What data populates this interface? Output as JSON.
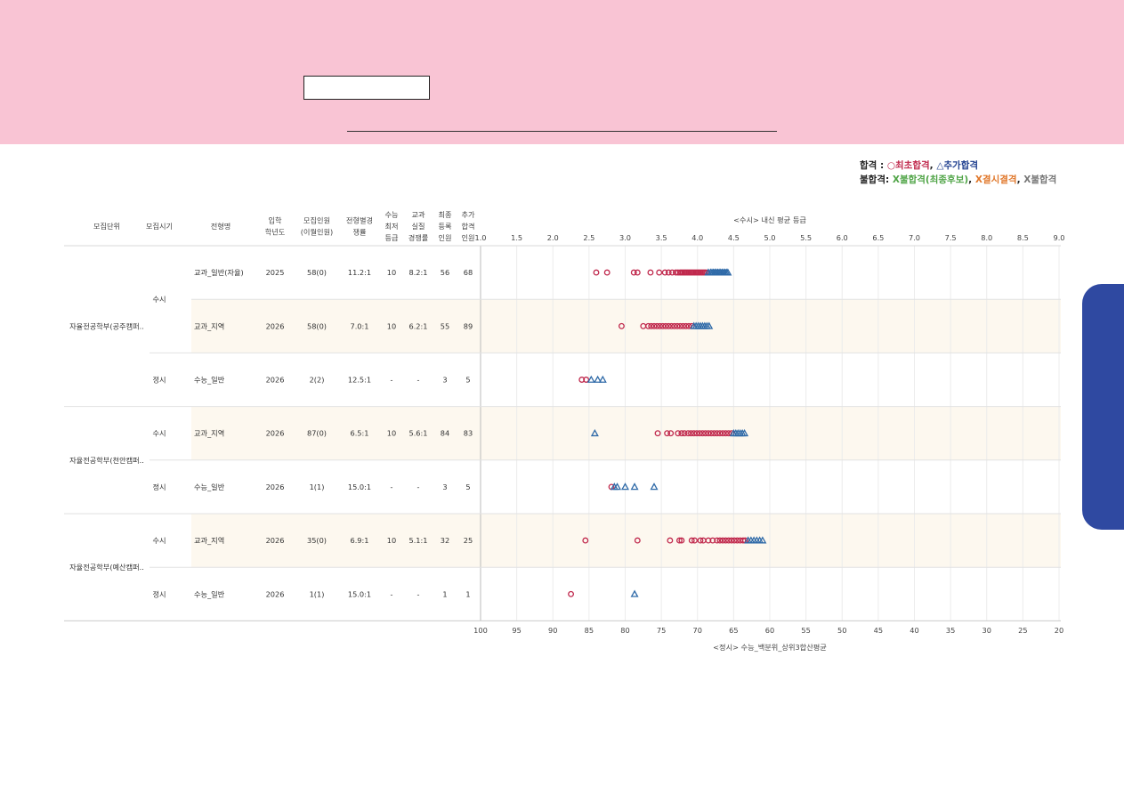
{
  "legend": {
    "pass_label": "합격",
    "pass_sep": " : ",
    "pass_first": "○최초합격",
    "pass_comma": ", ",
    "pass_add": "△추가합격",
    "fail_label": "불합격:",
    "fail_x1": "X불합격(최종후보)",
    "fail_comma1": ", ",
    "fail_x2": "X결시결격",
    "fail_comma2": ", ",
    "fail_x3": "X불합격"
  },
  "colors": {
    "first": "#c0294d",
    "additional": "#2f6aa8",
    "fail_final": "#4fa446",
    "fail_absent": "#e0772a",
    "fail": "#777777",
    "stripe": "#fdf8ef",
    "side_tab": "#2f49a1",
    "banner": "#f9c4d4"
  },
  "table": {
    "headers": [
      {
        "key": "unit",
        "lines": [
          "모집단위"
        ]
      },
      {
        "key": "period",
        "lines": [
          "모집시기"
        ]
      },
      {
        "key": "type",
        "lines": [
          "전형명"
        ]
      },
      {
        "key": "year",
        "lines": [
          "입학",
          "학년도"
        ]
      },
      {
        "key": "quota",
        "lines": [
          "모집인원",
          "(이월인원)"
        ]
      },
      {
        "key": "comp",
        "lines": [
          "전형별경",
          "쟁률"
        ]
      },
      {
        "key": "min",
        "lines": [
          "수능",
          "최저",
          "등급"
        ]
      },
      {
        "key": "real",
        "lines": [
          "교과",
          "실질",
          "경쟁률"
        ]
      },
      {
        "key": "reg",
        "lines": [
          "최종",
          "등록",
          "인원"
        ]
      },
      {
        "key": "add",
        "lines": [
          "추가",
          "합격",
          "인원"
        ]
      }
    ],
    "groups": [
      {
        "unit": "자율전공학부(공주캠퍼..",
        "periods": [
          {
            "name": "수시",
            "rows": 2
          },
          {
            "name": "정시",
            "rows": 1
          }
        ]
      },
      {
        "unit": "자율전공학부(천안캠퍼..",
        "periods": [
          {
            "name": "수시",
            "rows": 1
          },
          {
            "name": "정시",
            "rows": 1
          }
        ]
      },
      {
        "unit": "자율전공학부(예산캠퍼..",
        "periods": [
          {
            "name": "수시",
            "rows": 1
          },
          {
            "name": "정시",
            "rows": 1
          }
        ]
      }
    ],
    "rows": [
      {
        "type": "교과_일반(자율)",
        "year": "2025",
        "quota": "58(0)",
        "comp": "11.2:1",
        "min": "10",
        "real": "8.2:1",
        "reg": "56",
        "add": "68",
        "axis": "grade"
      },
      {
        "type": "교과_지역",
        "year": "2026",
        "quota": "58(0)",
        "comp": "7.0:1",
        "min": "10",
        "real": "6.2:1",
        "reg": "55",
        "add": "89",
        "axis": "grade"
      },
      {
        "type": "수능_일반",
        "year": "2026",
        "quota": "2(2)",
        "comp": "12.5:1",
        "min": "-",
        "real": "-",
        "reg": "3",
        "add": "5",
        "axis": "grade"
      },
      {
        "type": "교과_지역",
        "year": "2026",
        "quota": "87(0)",
        "comp": "6.5:1",
        "min": "10",
        "real": "5.6:1",
        "reg": "84",
        "add": "83",
        "axis": "grade"
      },
      {
        "type": "수능_일반",
        "year": "2026",
        "quota": "1(1)",
        "comp": "15.0:1",
        "min": "-",
        "real": "-",
        "reg": "3",
        "add": "5",
        "axis": "grade"
      },
      {
        "type": "교과_지역",
        "year": "2026",
        "quota": "35(0)",
        "comp": "6.9:1",
        "min": "10",
        "real": "5.1:1",
        "reg": "32",
        "add": "25",
        "axis": "grade"
      },
      {
        "type": "수능_일반",
        "year": "2026",
        "quota": "1(1)",
        "comp": "15.0:1",
        "min": "-",
        "real": "-",
        "reg": "1",
        "add": "1",
        "axis": "grade"
      }
    ]
  },
  "chart_data": {
    "type": "scatter",
    "top_axis_title": "<수시> 내신 평균 등급",
    "top_axis_ticks": [
      "1.0",
      "1.5",
      "2.0",
      "2.5",
      "3.0",
      "3.5",
      "4.0",
      "4.5",
      "5.0",
      "5.5",
      "6.0",
      "6.5",
      "7.0",
      "7.5",
      "8.0",
      "8.5",
      "9.0"
    ],
    "top_axis_range": [
      1.0,
      9.0
    ],
    "bottom_axis_title": "<정시> 수능_백분위_상위3합산평균",
    "bottom_axis_ticks": [
      "100",
      "95",
      "90",
      "85",
      "80",
      "75",
      "70",
      "65",
      "60",
      "55",
      "50",
      "45",
      "40",
      "35",
      "30",
      "25",
      "20"
    ],
    "bottom_axis_range": [
      100,
      20
    ],
    "rows": [
      {
        "first_x": [
          2.6,
          2.75,
          3.12,
          3.17,
          3.35,
          3.47,
          3.55,
          3.6,
          3.65,
          3.7,
          3.73,
          3.76,
          3.78,
          3.8,
          3.82,
          3.84,
          3.86,
          3.88,
          3.9,
          3.92,
          3.94,
          3.96,
          3.98,
          4.0,
          4.02,
          4.04,
          4.06,
          4.08,
          4.1,
          4.12
        ],
        "add_x": [
          4.15,
          4.18,
          4.2,
          4.22,
          4.24,
          4.26,
          4.28,
          4.3,
          4.32,
          4.34,
          4.36,
          4.38,
          4.4,
          4.42
        ]
      },
      {
        "first_x": [
          2.95,
          3.25,
          3.32,
          3.36,
          3.4,
          3.44,
          3.48,
          3.52,
          3.56,
          3.6,
          3.64,
          3.68,
          3.72,
          3.76,
          3.8,
          3.84,
          3.88,
          3.92
        ],
        "add_x": [
          3.95,
          3.98,
          4.01,
          4.04,
          4.07,
          4.1,
          4.13,
          4.16
        ]
      },
      {
        "first_x": [
          2.4,
          2.46
        ],
        "add_x": [
          2.53,
          2.62,
          2.69
        ]
      },
      {
        "first_x": [
          3.45,
          3.58,
          3.63,
          3.73,
          3.78,
          3.82,
          3.87,
          3.91,
          3.95,
          3.99,
          4.03,
          4.07,
          4.11,
          4.15,
          4.19,
          4.23,
          4.27,
          4.31,
          4.35,
          4.39,
          4.43,
          4.47
        ],
        "add_x": [
          2.58,
          4.5,
          4.53,
          4.56,
          4.59,
          4.62,
          4.65
        ]
      },
      {
        "first_x": [
          2.81
        ],
        "add_x": [
          2.85,
          2.89,
          3.0,
          3.13,
          3.4
        ]
      },
      {
        "first_x": [
          2.45,
          3.17,
          3.62,
          3.75,
          3.78,
          3.92,
          3.96,
          4.04,
          4.08,
          4.15,
          4.21,
          4.27,
          4.31,
          4.35,
          4.39,
          4.43,
          4.47,
          4.51,
          4.55,
          4.59,
          4.63,
          4.66
        ],
        "add_x": [
          4.7,
          4.74,
          4.78,
          4.82,
          4.86,
          4.9
        ]
      },
      {
        "first_x": [
          2.25
        ],
        "add_x": [
          3.13
        ]
      }
    ]
  }
}
